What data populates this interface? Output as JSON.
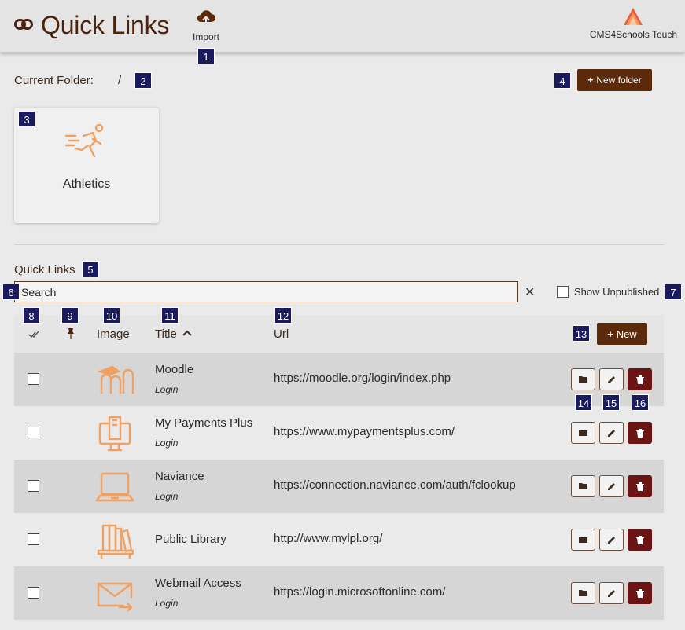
{
  "header": {
    "title": "Quick Links",
    "import_label": "Import",
    "brand_name": "CMS4Schools Touch"
  },
  "folder_bar": {
    "label": "Current Folder:",
    "path": "/",
    "new_folder_label": "New folder"
  },
  "folders": [
    {
      "name": "Athletics",
      "icon": "runner-icon"
    }
  ],
  "links_section": {
    "title": "Quick Links",
    "search_placeholder": "Search",
    "clear_symbol": "✕",
    "show_unpublished_label": "Show Unpublished",
    "new_label": "New"
  },
  "table": {
    "columns": {
      "select": "select-all-icon",
      "pin": "pin-icon",
      "image": "Image",
      "title": "Title",
      "url": "Url"
    },
    "sort_indicator": "chevron-up-icon",
    "rows": [
      {
        "title": "Moodle",
        "subtitle": "Login",
        "url": "https://moodle.org/login/index.php",
        "icon": "moodle-icon"
      },
      {
        "title": "My Payments Plus",
        "subtitle": "Login",
        "url": "https://www.mypaymentsplus.com/",
        "icon": "payments-monitor-icon"
      },
      {
        "title": "Naviance",
        "subtitle": "Login",
        "url": "https://connection.naviance.com/auth/fclookup",
        "icon": "laptop-icon"
      },
      {
        "title": "Public Library",
        "subtitle": "",
        "url": "http://www.mylpl.org/",
        "icon": "bookshelf-icon"
      },
      {
        "title": "Webmail Access",
        "subtitle": "Login",
        "url": "https://login.microsoftonline.com/",
        "icon": "envelope-icon"
      }
    ]
  },
  "badges": [
    "1",
    "2",
    "3",
    "4",
    "5",
    "6",
    "7",
    "8",
    "9",
    "10",
    "11",
    "12",
    "13",
    "14",
    "15",
    "16"
  ],
  "colors": {
    "primary_brown": "#5a2a0a",
    "delete_red": "#6a1414",
    "icon_orange": "#f0a060",
    "badge_navy": "#1a1a5e"
  }
}
